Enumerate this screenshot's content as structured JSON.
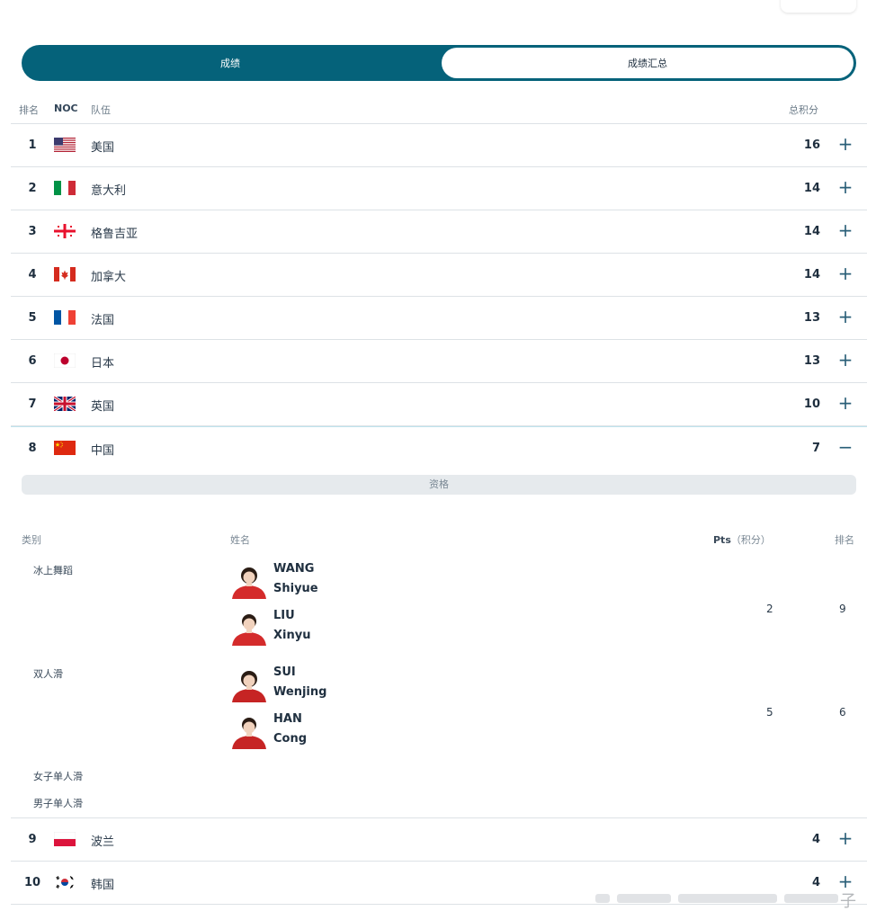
{
  "tabs": [
    {
      "label": "成绩",
      "active": true
    },
    {
      "label": "成绩汇总",
      "active": false
    }
  ],
  "header": {
    "rank": "排名",
    "noc": "NOC",
    "team": "队伍",
    "total": "总积分"
  },
  "teams": [
    {
      "rank": "1",
      "flag": "usa-flag",
      "name": "美国",
      "score": "16",
      "toggle": "+"
    },
    {
      "rank": "2",
      "flag": "italy-flag",
      "name": "意大利",
      "score": "14",
      "toggle": "+"
    },
    {
      "rank": "3",
      "flag": "georgia-flag",
      "name": "格鲁吉亚",
      "score": "14",
      "toggle": "+"
    },
    {
      "rank": "4",
      "flag": "canada-flag",
      "name": "加拿大",
      "score": "14",
      "toggle": "+"
    },
    {
      "rank": "5",
      "flag": "france-flag",
      "name": "法国",
      "score": "13",
      "toggle": "+"
    },
    {
      "rank": "6",
      "flag": "japan-flag",
      "name": "日本",
      "score": "13",
      "toggle": "+"
    },
    {
      "rank": "7",
      "flag": "uk-flag",
      "name": "英国",
      "score": "10",
      "toggle": "+"
    },
    {
      "rank": "8",
      "flag": "china-flag",
      "name": "中国",
      "score": "7",
      "toggle": "−"
    },
    {
      "rank": "9",
      "flag": "poland-flag",
      "name": "波兰",
      "score": "4",
      "toggle": "+"
    },
    {
      "rank": "10",
      "flag": "korea-flag",
      "name": "韩国",
      "score": "4",
      "toggle": "+"
    }
  ],
  "detail": {
    "qualification_label": "资格",
    "headers": {
      "category": "类别",
      "name": "姓名",
      "pts": "Pts",
      "pts_unit": "（积分）",
      "rank": "排名"
    },
    "categories": [
      {
        "label": "冰上舞蹈",
        "pts": "2",
        "rank": "9",
        "athletes": [
          {
            "first": "WANG",
            "last": "Shiyue"
          },
          {
            "first": "LIU",
            "last": "Xinyu"
          }
        ]
      },
      {
        "label": "双人滑",
        "pts": "5",
        "rank": "6",
        "athletes": [
          {
            "first": "SUI",
            "last": "Wenjing"
          },
          {
            "first": "HAN",
            "last": "Cong"
          }
        ]
      },
      {
        "label": "女子单人滑"
      },
      {
        "label": "男子单人滑"
      }
    ]
  },
  "colors": {
    "accent": "#05627a",
    "divider": "#dde2e6",
    "flag_red": "#d42b2b"
  },
  "watermark_char": "子"
}
